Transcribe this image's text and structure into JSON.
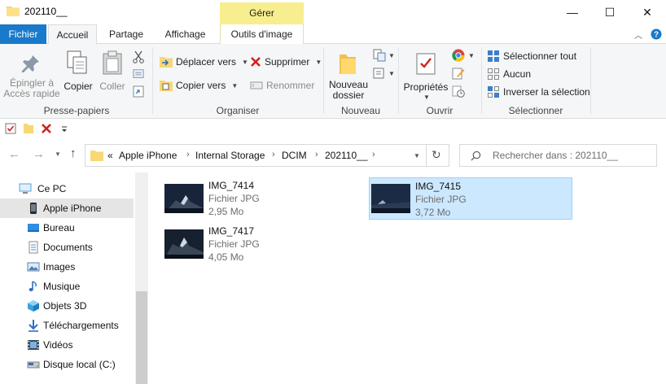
{
  "window": {
    "title": "202110__",
    "minimize": "—",
    "maximize": "☐",
    "close": "✕"
  },
  "context_tab": {
    "label": "Gérer"
  },
  "tabs": [
    {
      "label": "Fichier"
    },
    {
      "label": "Accueil"
    },
    {
      "label": "Partage"
    },
    {
      "label": "Affichage"
    },
    {
      "label": "Outils d'image"
    }
  ],
  "ribbon": {
    "presse_papiers": {
      "label": "Presse-papiers",
      "pin_line1": "Épingler à",
      "pin_line2": "Accès rapide",
      "copy": "Copier",
      "paste": "Coller"
    },
    "organiser": {
      "label": "Organiser",
      "move_to": "Déplacer vers",
      "copy_to": "Copier vers",
      "delete": "Supprimer",
      "rename": "Renommer"
    },
    "nouveau": {
      "label": "Nouveau",
      "new_folder_line1": "Nouveau",
      "new_folder_line2": "dossier"
    },
    "ouvrir": {
      "label": "Ouvrir",
      "properties": "Propriétés"
    },
    "selectionner": {
      "label": "Sélectionner",
      "select_all": "Sélectionner tout",
      "select_none": "Aucun",
      "invert": "Inverser la sélection"
    }
  },
  "address": {
    "prefix": "«",
    "crumbs": [
      "Apple iPhone",
      "Internal Storage",
      "DCIM",
      "202110__"
    ]
  },
  "search": {
    "placeholder": "Rechercher dans : 202110__"
  },
  "nav": [
    {
      "label": "Ce PC",
      "icon": "pc-icon"
    },
    {
      "label": "Apple iPhone",
      "icon": "phone-icon",
      "selected": true
    },
    {
      "label": "Bureau",
      "icon": "desktop-icon"
    },
    {
      "label": "Documents",
      "icon": "documents-icon"
    },
    {
      "label": "Images",
      "icon": "pictures-icon"
    },
    {
      "label": "Musique",
      "icon": "music-icon"
    },
    {
      "label": "Objets 3D",
      "icon": "3d-objects-icon"
    },
    {
      "label": "Téléchargements",
      "icon": "downloads-icon"
    },
    {
      "label": "Vidéos",
      "icon": "videos-icon"
    },
    {
      "label": "Disque local (C:)",
      "icon": "drive-icon"
    }
  ],
  "files": [
    {
      "name": "IMG_7414",
      "type": "Fichier JPG",
      "size": "2,95 Mo"
    },
    {
      "name": "IMG_7415",
      "type": "Fichier JPG",
      "size": "3,72 Mo",
      "selected": true
    },
    {
      "name": "IMG_7417",
      "type": "Fichier JPG",
      "size": "4,05 Mo"
    }
  ],
  "colors": {
    "accent": "#1979ca",
    "context_band": "#f7ee8f",
    "selection": "#cce8ff",
    "delete_red": "#d42020"
  }
}
